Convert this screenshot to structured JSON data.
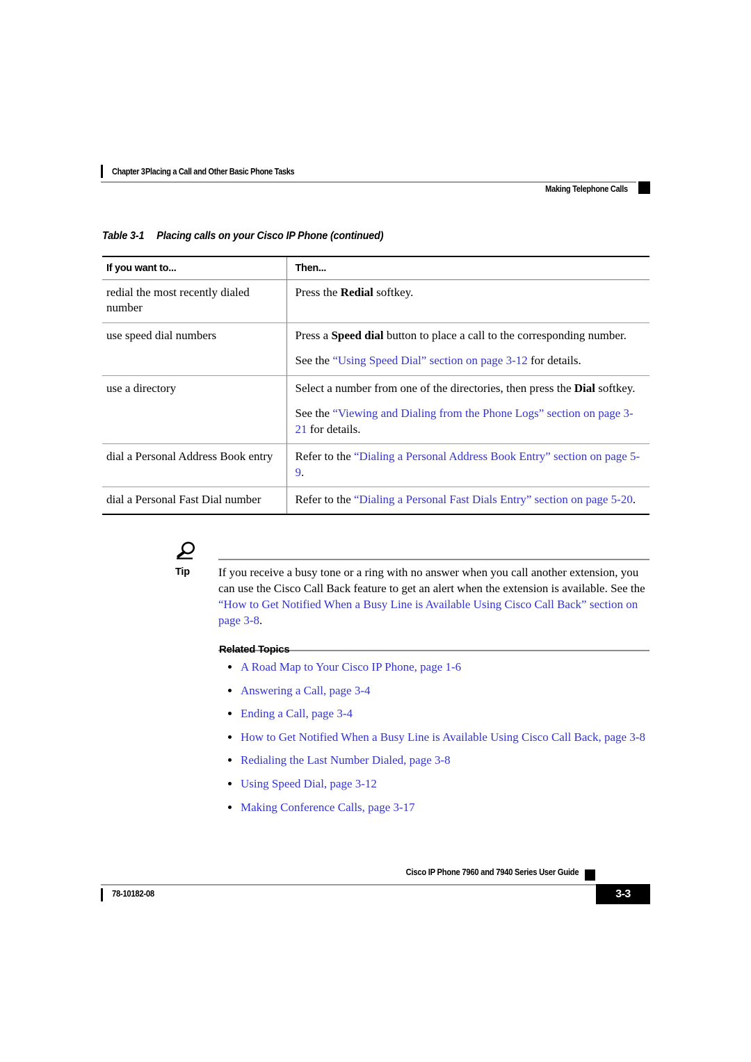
{
  "header": {
    "chapter_label": "Chapter 3",
    "chapter_title": "Placing a Call and Other Basic Phone Tasks",
    "section": "Making Telephone Calls"
  },
  "table": {
    "caption_number": "Table 3-1",
    "caption_title": "Placing calls on your Cisco IP Phone (continued)",
    "columns": [
      "If you want to...",
      "Then..."
    ],
    "rows": [
      {
        "want": "redial the most recently dialed number",
        "then_paragraphs": [
          [
            {
              "t": "Press the ",
              "s": "plain"
            },
            {
              "t": "Redial",
              "s": "bold"
            },
            {
              "t": " softkey.",
              "s": "plain"
            }
          ]
        ]
      },
      {
        "want": "use speed dial numbers",
        "then_paragraphs": [
          [
            {
              "t": "Press a ",
              "s": "plain"
            },
            {
              "t": "Speed dial",
              "s": "bold"
            },
            {
              "t": " button to place a call to the corresponding number.",
              "s": "plain"
            }
          ],
          [
            {
              "t": "See the ",
              "s": "plain"
            },
            {
              "t": "“Using Speed Dial” section on page 3-12",
              "s": "link"
            },
            {
              "t": " for details.",
              "s": "plain"
            }
          ]
        ]
      },
      {
        "want": "use a directory",
        "then_paragraphs": [
          [
            {
              "t": "Select a number from one of the directories, then press the ",
              "s": "plain"
            },
            {
              "t": "Dial",
              "s": "bold"
            },
            {
              "t": " softkey.",
              "s": "plain"
            }
          ],
          [
            {
              "t": "See the ",
              "s": "plain"
            },
            {
              "t": "“Viewing and Dialing from the Phone Logs” section on page 3-21",
              "s": "link"
            },
            {
              "t": " for details.",
              "s": "plain"
            }
          ]
        ]
      },
      {
        "want": "dial a Personal Address Book entry",
        "then_paragraphs": [
          [
            {
              "t": "Refer to the ",
              "s": "plain"
            },
            {
              "t": "“Dialing a Personal Address Book Entry” section on page 5-9",
              "s": "link"
            },
            {
              "t": ".",
              "s": "plain"
            }
          ]
        ]
      },
      {
        "want": "dial a Personal Fast Dial number",
        "then_paragraphs": [
          [
            {
              "t": "Refer to the ",
              "s": "plain"
            },
            {
              "t": "“Dialing a Personal Fast Dials Entry” section on page 5-20",
              "s": "link"
            },
            {
              "t": ".",
              "s": "plain"
            }
          ]
        ]
      }
    ]
  },
  "tip": {
    "label": "Tip",
    "icon": "tip-magnifier-icon",
    "segments": [
      {
        "t": "If you receive a busy tone or a ring with no answer when you call another extension, you can use the Cisco Call Back feature to get an alert when the extension is available. See the ",
        "s": "plain"
      },
      {
        "t": "“How to Get Notified When a Busy Line is Available Using Cisco Call Back” section on page 3-8",
        "s": "link"
      },
      {
        "t": ".",
        "s": "plain"
      }
    ]
  },
  "related": {
    "title": "Related Topics",
    "items": [
      "A Road Map to Your Cisco IP Phone, page 1-6",
      "Answering a Call, page 3-4",
      "Ending a Call, page 3-4",
      "How to Get Notified When a Busy Line is Available Using Cisco Call Back, page 3-8",
      "Redialing the Last Number Dialed, page 3-8",
      "Using Speed Dial, page 3-12",
      "Making Conference Calls, page 3-17"
    ]
  },
  "footer": {
    "guide_title": "Cisco IP Phone 7960 and 7940 Series User Guide",
    "doc_number": "78-10182-08",
    "page_number": "3-3"
  },
  "colors": {
    "link": "#3333cc",
    "rule": "#9a9a9a",
    "text": "#000000"
  }
}
